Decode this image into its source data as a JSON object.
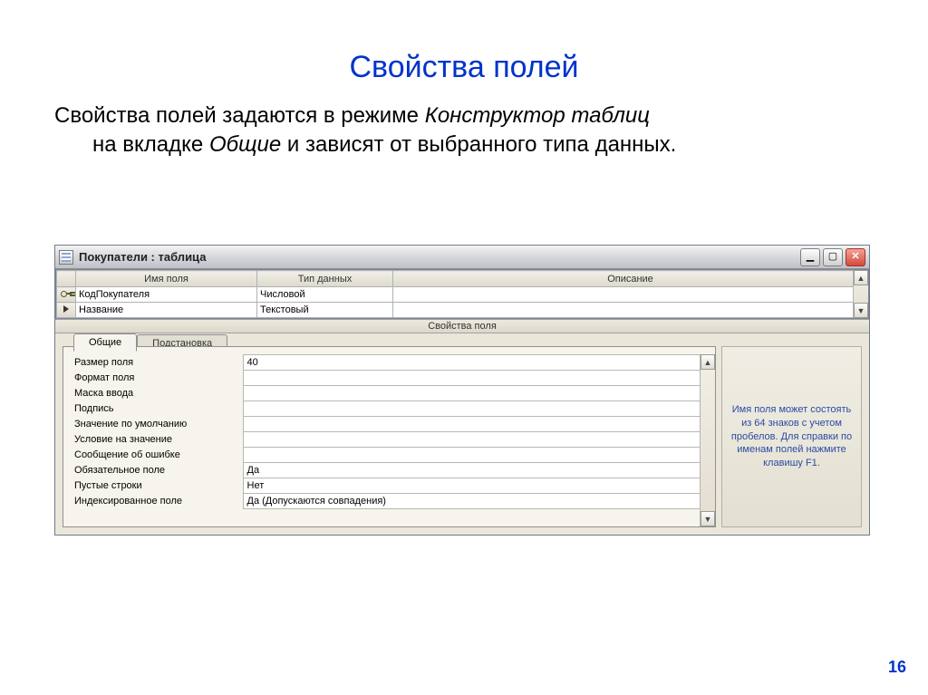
{
  "slide": {
    "title": "Свойства полей",
    "body_seg1": "Свойства полей задаются в режиме ",
    "body_em1": "Конструктор таблиц",
    "body_seg2": " на вкладке ",
    "body_em2": "Общие",
    "body_seg3": " и зависят от выбранного типа данных.",
    "page": "16"
  },
  "window": {
    "title": "Покупатели : таблица",
    "columns": {
      "name": "Имя поля",
      "type": "Тип данных",
      "desc": "Описание"
    },
    "rows": [
      {
        "key": true,
        "current": false,
        "name": "КодПокупателя",
        "type": "Числовой",
        "desc": ""
      },
      {
        "key": false,
        "current": true,
        "name": "Название",
        "type": "Текстовый",
        "desc": ""
      }
    ],
    "sep": "Свойства поля",
    "tabs": {
      "general": "Общие",
      "lookup": "Подстановка"
    },
    "props": [
      {
        "k": "Размер поля",
        "v": "40"
      },
      {
        "k": "Формат поля",
        "v": ""
      },
      {
        "k": "Маска ввода",
        "v": ""
      },
      {
        "k": "Подпись",
        "v": ""
      },
      {
        "k": "Значение по умолчанию",
        "v": ""
      },
      {
        "k": "Условие на значение",
        "v": ""
      },
      {
        "k": "Сообщение об ошибке",
        "v": ""
      },
      {
        "k": "Обязательное поле",
        "v": "Да"
      },
      {
        "k": "Пустые строки",
        "v": "Нет"
      },
      {
        "k": "Индексированное поле",
        "v": "Да (Допускаются совпадения)"
      }
    ],
    "help": "Имя поля может состоять из 64 знаков с учетом пробелов.  Для справки по именам полей нажмите клавишу F1."
  }
}
